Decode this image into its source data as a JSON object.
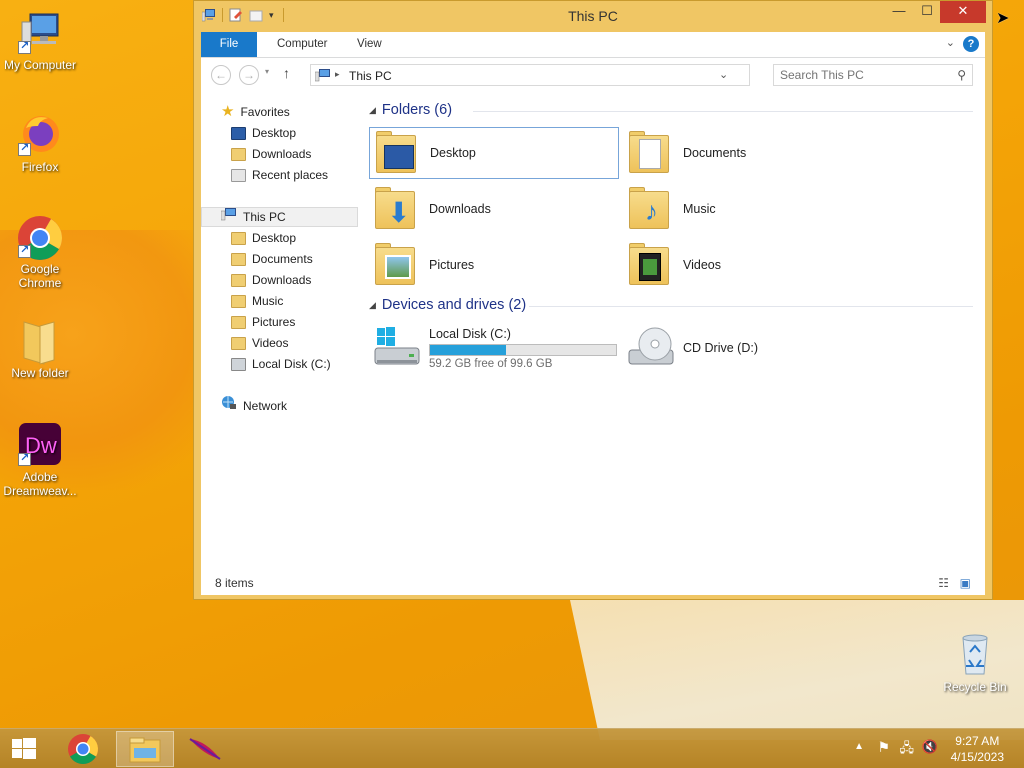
{
  "desktop": {
    "icons": [
      {
        "label": "My Computer"
      },
      {
        "label": "Firefox"
      },
      {
        "label": "Google Chrome"
      },
      {
        "label": "New folder"
      },
      {
        "label": "Adobe Dreamweav..."
      },
      {
        "label": "Recycle Bin"
      }
    ]
  },
  "window": {
    "title": "This PC",
    "buttons": {
      "minimize": "—",
      "maximize": "☐",
      "close": "✕"
    }
  },
  "ribbon": {
    "tabs": [
      "File",
      "Computer",
      "View"
    ]
  },
  "address": {
    "path": "This PC",
    "search_placeholder": "Search This PC"
  },
  "nav": {
    "favorites": "Favorites",
    "fav_items": [
      "Desktop",
      "Downloads",
      "Recent places"
    ],
    "this_pc": "This PC",
    "pc_items": [
      "Desktop",
      "Documents",
      "Downloads",
      "Music",
      "Pictures",
      "Videos",
      "Local Disk (C:)"
    ],
    "network": "Network"
  },
  "content": {
    "folders_header": "Folders (6)",
    "folders": [
      "Desktop",
      "Documents",
      "Downloads",
      "Music",
      "Pictures",
      "Videos"
    ],
    "drives_header": "Devices and drives (2)",
    "drives": [
      {
        "name": "Local Disk (C:)",
        "free": "59.2 GB free of 99.6 GB",
        "used_fraction": 0.41
      },
      {
        "name": "CD Drive (D:)"
      }
    ]
  },
  "status": {
    "item_count": "8 items"
  },
  "taskbar": {
    "time": "9:27 AM",
    "date": "4/15/2023"
  },
  "colors": {
    "accent": "#1979ca",
    "window_frame": "#f0c664",
    "drive_bar": "#26a0da"
  }
}
